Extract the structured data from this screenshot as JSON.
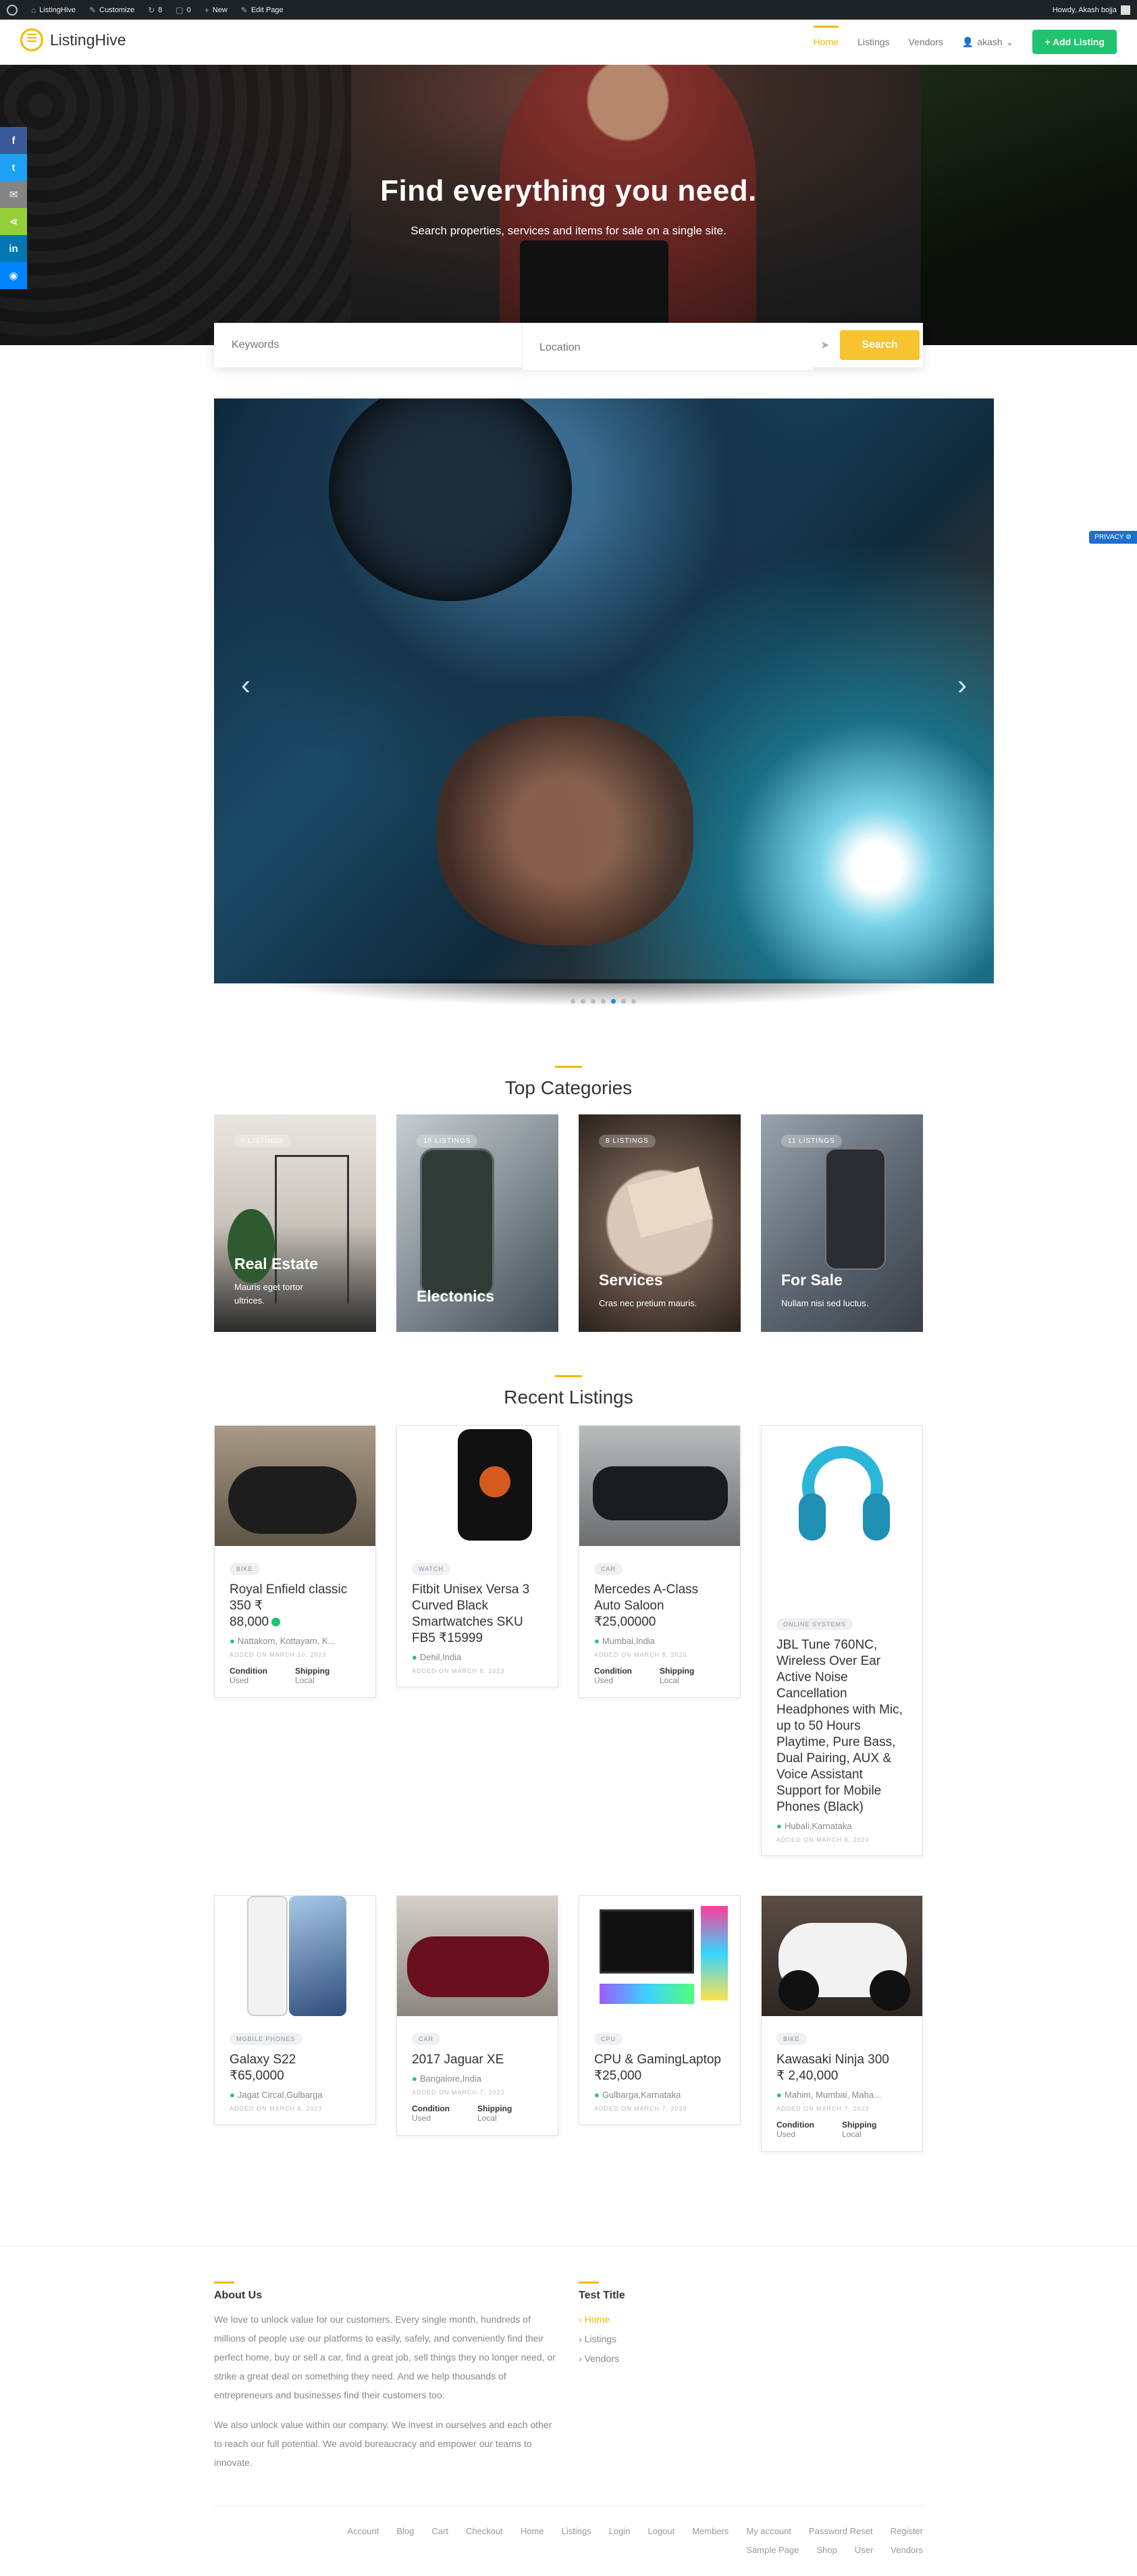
{
  "adminbar": {
    "site": "ListingHive",
    "customize": "Customize",
    "updates": "8",
    "comments": "0",
    "new": "New",
    "edit": "Edit Page",
    "howdy": "Howdy, Akash bojja"
  },
  "header": {
    "logo": "ListingHive",
    "nav": [
      "Home",
      "Listings",
      "Vendors"
    ],
    "user": "akash",
    "add_listing": "Add Listing"
  },
  "hero": {
    "title": "Find everything you need.",
    "subtitle": "Search properties, services and items for sale on a single site."
  },
  "search": {
    "keywords_placeholder": "Keywords",
    "location_placeholder": "Location",
    "button": "Search"
  },
  "privacy": "PRIVACY",
  "slider": {
    "dots": 7,
    "active_dot": 5
  },
  "categories": {
    "title": "Top Categories",
    "items": [
      {
        "count": "6 LISTINGS",
        "name": "Real Estate",
        "desc": "Mauris eget tortor ultrices."
      },
      {
        "count": "10 LISTINGS",
        "name": "Electonics",
        "desc": ""
      },
      {
        "count": "8 LISTINGS",
        "name": "Services",
        "desc": "Cras nec pretium mauris."
      },
      {
        "count": "11 LISTINGS",
        "name": "For Sale",
        "desc": "Nullam nisi sed luctus."
      }
    ]
  },
  "recent": {
    "title": "Recent Listings",
    "listings": [
      {
        "tag": "BIKE",
        "title": "Royal Enfield classic 350 ₹",
        "price": "88,000",
        "verified": true,
        "location": "Nattakom, Kottayam, K...",
        "added": "ADDED ON MARCH 10, 2023",
        "condition_label": "Condition",
        "condition": "Used",
        "shipping_label": "Shipping",
        "shipping": "Local"
      },
      {
        "tag": "WATCH",
        "title": "Fitbit Unisex Versa 3 Curved Black Smartwatches SKU FB5 ₹15999",
        "price": "",
        "location": "Dehil,India",
        "added": "ADDED ON MARCH 8, 2023"
      },
      {
        "tag": "CAR",
        "title": "Mercedes A-Class Auto Saloon",
        "price": "₹25,00000",
        "location": "Mumbai,India",
        "added": "ADDED ON MARCH 8, 2023",
        "condition_label": "Condition",
        "condition": "Used",
        "shipping_label": "Shipping",
        "shipping": "Local"
      },
      {
        "tag": "ONLINE SYSTEMS",
        "title": "JBL Tune 760NC, Wireless Over Ear Active Noise Cancellation Headphones with Mic, up to 50 Hours Playtime, Pure Bass, Dual Pairing, AUX & Voice Assistant Support for Mobile Phones (Black)",
        "price": "",
        "location": "Hubali,Karnataka",
        "added": "ADDED ON MARCH 8, 2023"
      },
      {
        "tag": "MOBILE PHONES",
        "title": "Galaxy S22",
        "price": "₹65,0000",
        "location": "Jagat Circal,Gulbarga",
        "added": "ADDED ON MARCH 8, 2023"
      },
      {
        "tag": "CAR",
        "title": "2017 Jaguar XE",
        "price": "",
        "location": "Bangalore,India",
        "added": "ADDED ON MARCH 7, 2023",
        "condition_label": "Condition",
        "condition": "Used",
        "shipping_label": "Shipping",
        "shipping": "Local"
      },
      {
        "tag": "CPU",
        "title": "CPU & GamingLaptop",
        "price": "₹25,000",
        "location": "Gulbarga,Karnataka",
        "added": "ADDED ON MARCH 7, 2023"
      },
      {
        "tag": "BIKE",
        "title": "Kawasaki Ninja 300",
        "price": "₹ 2,40,000",
        "location": "Mahim, Mumbai, Maha...",
        "added": "ADDED ON MARCH 7, 2023",
        "condition_label": "Condition",
        "condition": "Used",
        "shipping_label": "Shipping",
        "shipping": "Local"
      }
    ]
  },
  "footer": {
    "about_title": "About Us",
    "about_p1": "We love to unlock value for our customers. Every single month, hundreds of millions of people use our platforms to easily, safely, and conveniently find their perfect home, buy or sell a car, find a great job, sell things they no longer need, or strike a great deal on something they need. And we help thousands of entrepreneurs and businesses find their customers too.",
    "about_p2": "We also unlock value within our company. We invest in ourselves and each other to reach our full potential. We avoid bureaucracy and empower our teams to innovate.",
    "test_title": "Test Title",
    "links": [
      "Home",
      "Listings",
      "Vendors"
    ],
    "nav_row1": [
      "Account",
      "Blog",
      "Cart",
      "Checkout",
      "Home",
      "Listings",
      "Login",
      "Logout",
      "Members",
      "My account",
      "Password Reset",
      "Register"
    ],
    "nav_row2": [
      "Sample Page",
      "Shop",
      "User",
      "Vendors"
    ]
  }
}
